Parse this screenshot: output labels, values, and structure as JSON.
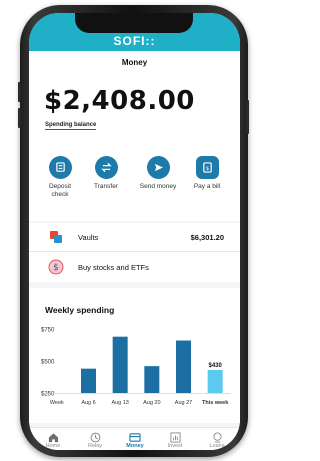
{
  "header": {
    "logo": "SOFI::"
  },
  "page": {
    "title": "Money"
  },
  "balance": {
    "amount": "$2,408.00",
    "label": "Spending balance"
  },
  "actions": [
    {
      "label": "Deposit check",
      "icon": "deposit-icon"
    },
    {
      "label": "Transfer",
      "icon": "transfer-icon"
    },
    {
      "label": "Send money",
      "icon": "send-icon"
    },
    {
      "label": "Pay a bill",
      "icon": "bill-icon"
    }
  ],
  "vaults": {
    "label": "Vaults",
    "amount": "$6,301.20"
  },
  "invest": {
    "label": "Buy stocks and ETFs"
  },
  "weekly": {
    "title": "Weekly spending"
  },
  "chart_data": {
    "type": "bar",
    "categories": [
      "Week",
      "Aug 6",
      "Aug 13",
      "Aug 20",
      "Aug 27",
      "This week"
    ],
    "values": [
      null,
      440,
      690,
      460,
      660,
      430
    ],
    "highlight_label": "$430",
    "y_ticks": [
      "$750",
      "$500",
      "$250"
    ],
    "ylim": [
      250,
      750
    ],
    "colors": {
      "bar": "#1d6fa3",
      "current": "#5ccaf0"
    }
  },
  "tabs": [
    {
      "label": "Home",
      "icon": "home-icon"
    },
    {
      "label": "Relay",
      "icon": "relay-icon"
    },
    {
      "label": "Money",
      "icon": "money-icon",
      "active": true
    },
    {
      "label": "Invest",
      "icon": "invest-icon"
    },
    {
      "label": "Loans",
      "icon": "loans-icon"
    }
  ]
}
